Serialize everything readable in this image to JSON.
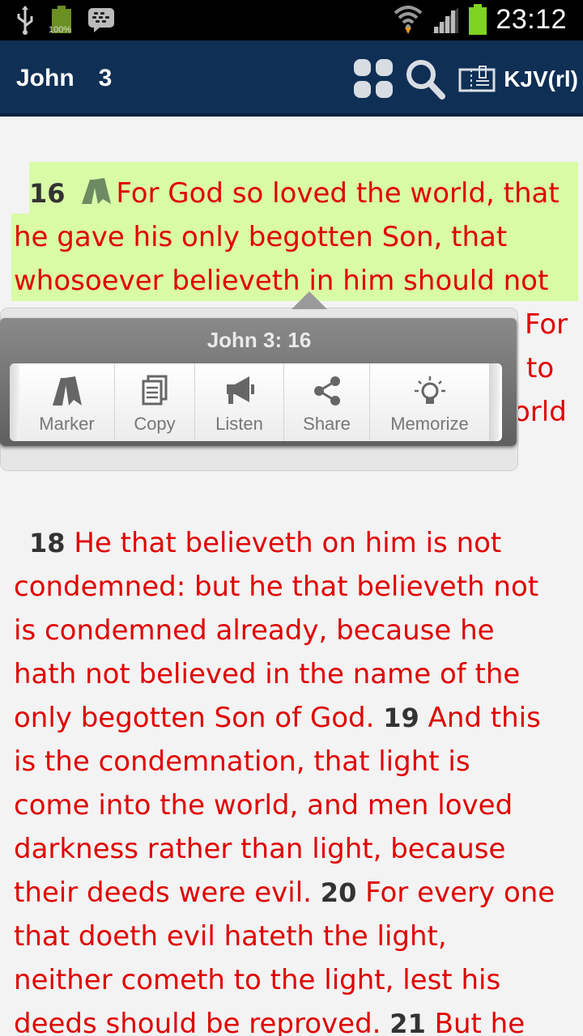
{
  "status_bar": {
    "battery_small_label": "100%",
    "time": "23:12",
    "icons": [
      "usb-icon",
      "battery-icon",
      "bbm-icon",
      "wifi-icon",
      "signal-icon",
      "battery-icon"
    ]
  },
  "app_bar": {
    "book": "John",
    "chapter": "3",
    "version": "KJV(rl)",
    "icons": [
      "grid-icon",
      "search-icon",
      "book-icon"
    ]
  },
  "popup": {
    "title": "John 3: 16",
    "actions": [
      {
        "label": "Marker",
        "icon": "marker-icon"
      },
      {
        "label": "Copy",
        "icon": "copy-icon"
      },
      {
        "label": "Listen",
        "icon": "megaphone-icon"
      },
      {
        "label": "Share",
        "icon": "share-icon"
      },
      {
        "label": "Memorize",
        "icon": "lightbulb-icon"
      }
    ]
  },
  "text": {
    "v16_num": "16",
    "v16_l1": "For God so loved the world, that",
    "v16_l2": "he gave his only begotten Son, that",
    "v16_l3": "whosoever believeth in him should not",
    "r1": "For",
    "r2": "to",
    "r3": "orld",
    "v18_num": "18",
    "l1": "He that believeth on him is not",
    "l2": "condemned: but he that believeth not",
    "l3": "is condemned already, because he",
    "l4": "hath not believed in the name of the",
    "l5a": "only begotten Son of God.",
    "v19_num": "19",
    "l5b": "And this",
    "l6": "is the condemnation, that light is",
    "l7": "come into the world, and men loved",
    "l8": "darkness rather than light, because",
    "l9a": "their deeds were evil.",
    "v20_num": "20",
    "l9b": "For every one",
    "l10": "that doeth evil hateth the light,",
    "l11": "neither cometh to the light, lest his",
    "l12a": "deeds should be reproved.",
    "v21_num": "21",
    "l12b": "But he"
  },
  "colors": {
    "app_bar": "#0f2f55",
    "verse_text": "#e00000",
    "highlight": "#d9fba6",
    "verse_number": "#333333"
  }
}
